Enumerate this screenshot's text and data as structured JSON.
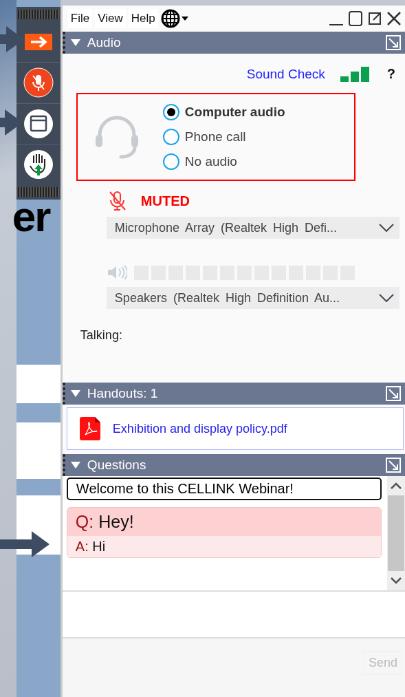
{
  "menu": [
    {
      "label": "File"
    },
    {
      "label": "View"
    },
    {
      "label": "Help"
    }
  ],
  "audio": {
    "title": "Audio",
    "sound_check": "Sound Check",
    "help": "?",
    "options": [
      {
        "label": "Computer audio",
        "selected": true
      },
      {
        "label": "Phone call",
        "selected": false
      },
      {
        "label": "No audio",
        "selected": false
      }
    ],
    "mic_status": "MUTED",
    "microphone": "Microphone Array (Realtek High Defi...",
    "speakers": "Speakers (Realtek High Definition Au...",
    "talking": "Talking:"
  },
  "handouts": {
    "title": "Handouts: 1",
    "files": [
      "Exhibition and display policy.pdf"
    ]
  },
  "questions": {
    "title": "Questions",
    "banner": "Welcome to this CELLINK Webinar!",
    "items": [
      {
        "q_label": "Q:",
        "question": "Hey!",
        "a_label": "A:",
        "answer": "Hi"
      }
    ],
    "send": "Send",
    "send_disabled": true
  },
  "background": {
    "text": "er"
  }
}
